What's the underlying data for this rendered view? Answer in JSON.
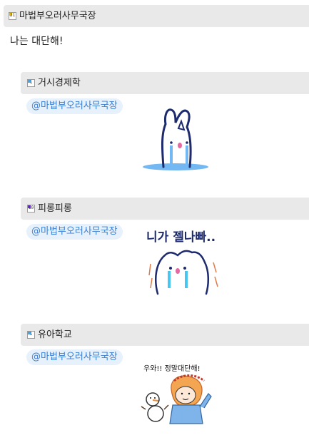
{
  "thread": {
    "author": "마법부오러사무국장",
    "author_badge": "21",
    "message": "나는 대단해!"
  },
  "replies": [
    {
      "author": "거시경제학",
      "badge": "1",
      "badge_color": "#4aa3e0",
      "mention": "@마법부오러사무국장",
      "sticker_text": ""
    },
    {
      "author": "피롱피롱",
      "badge": "10",
      "badge_color": "#6a2bd8",
      "mention": "@마법부오러사무국장",
      "sticker_text": "니가 젤나빠.."
    },
    {
      "author": "유아학교",
      "badge": "1",
      "badge_color": "#4aa3e0",
      "mention": "@마법부오러사무국장",
      "sticker_text": "우와!! 정말대단해!"
    }
  ]
}
